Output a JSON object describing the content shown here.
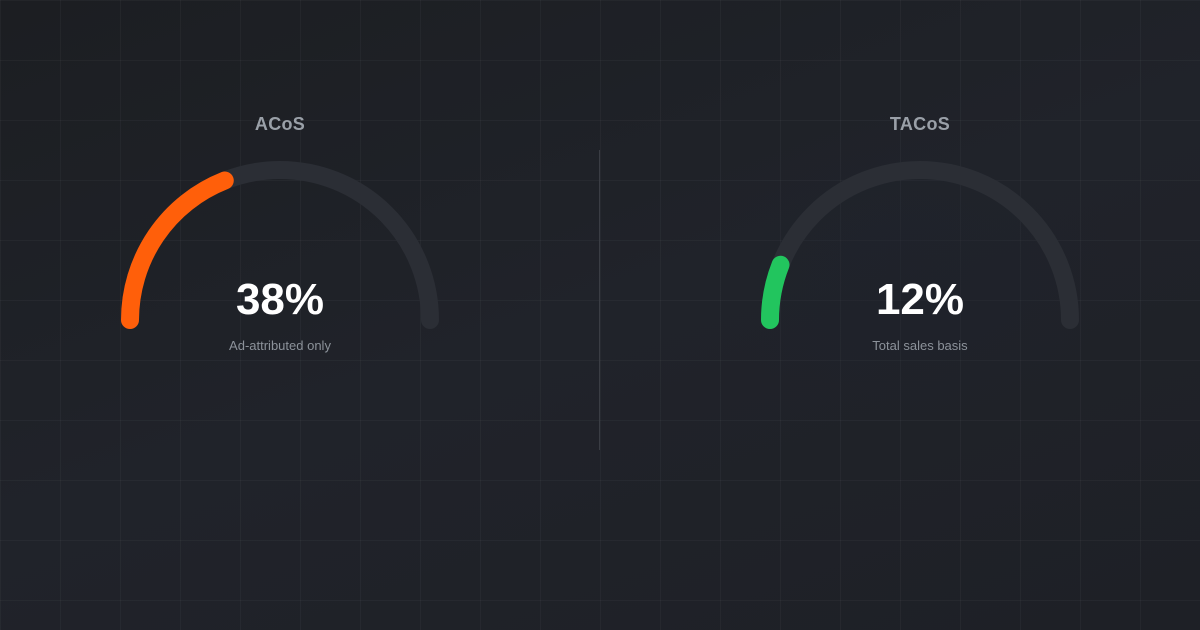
{
  "chart_data": [
    {
      "type": "gauge",
      "title": "ACoS",
      "value": 38,
      "unit": "%",
      "value_label": "38%",
      "caption": "Ad-attributed only",
      "range": [
        0,
        100
      ],
      "color": "#ff5f0a",
      "track_color": "#2b2e35"
    },
    {
      "type": "gauge",
      "title": "TACoS",
      "value": 12,
      "unit": "%",
      "value_label": "12%",
      "caption": "Total sales basis",
      "range": [
        0,
        100
      ],
      "color": "#22c55e",
      "track_color": "#2b2e35"
    }
  ]
}
